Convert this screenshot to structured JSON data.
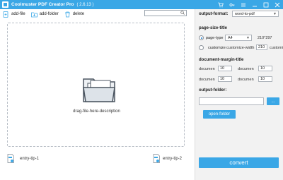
{
  "window": {
    "title": "Coolmuster PDF Creator Pro",
    "version": "( 2.6.13 )",
    "icons": [
      "cart-icon",
      "key-icon",
      "settings-icon",
      "minimize-icon",
      "maximize-icon",
      "close-icon"
    ]
  },
  "toolbar": {
    "add_file": "add-file",
    "add_folder": "add-folder",
    "delete": "delete",
    "search_value": ""
  },
  "dropzone": {
    "description": "drag-file-here-description"
  },
  "entry_tips": {
    "tip1": "entry-tip-1",
    "tip2": "entry-tip-2"
  },
  "settings": {
    "output_format_label": "output-format:",
    "output_format_value": "word-to-pdf",
    "page_size_title": "page-size-title",
    "page_type_label": "page-type",
    "page_type_value": "A4",
    "page_type_dims": "210*297",
    "customize_label": "customize",
    "customize_width_label": "customize-width",
    "customize_width_value": "210",
    "customize_height_label": "customize",
    "margin_title": "document-margin-title",
    "margins": [
      {
        "label": "documen",
        "value": "10"
      },
      {
        "label": "documen",
        "value": "10"
      },
      {
        "label": "documen",
        "value": "10"
      },
      {
        "label": "documen",
        "value": "10"
      }
    ],
    "output_folder_label": "output-folder:",
    "output_folder_value": "",
    "browse_label": "...",
    "open_folder_label": "open-folder",
    "convert_label": "convert"
  },
  "colors": {
    "accent": "#3aa7e6",
    "panel_bg": "#f2f2f2"
  }
}
